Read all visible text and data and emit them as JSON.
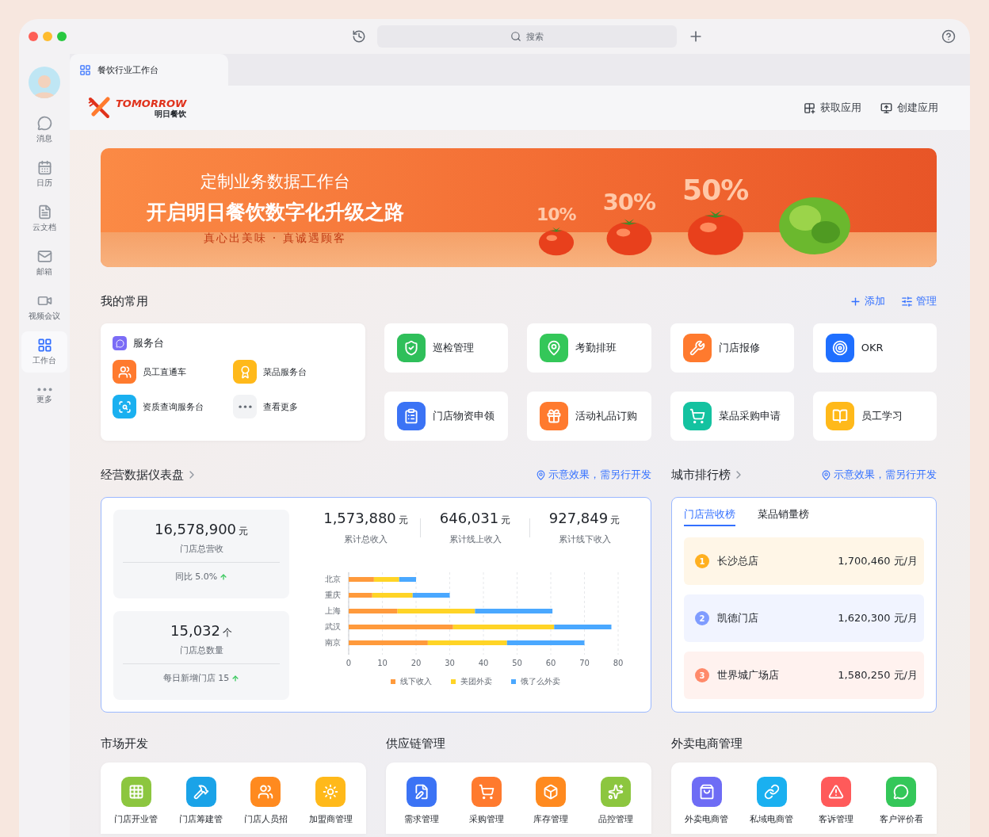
{
  "window": {
    "search_placeholder": "搜索"
  },
  "sidebar": {
    "items": [
      {
        "label": "消息",
        "kind": "chat",
        "selected": false
      },
      {
        "label": "日历",
        "kind": "calendar",
        "selected": false
      },
      {
        "label": "云文档",
        "kind": "docs",
        "selected": false
      },
      {
        "label": "邮箱",
        "kind": "mail",
        "selected": false
      },
      {
        "label": "视频会议",
        "kind": "video",
        "selected": false
      },
      {
        "label": "工作台",
        "kind": "workspace",
        "selected": true
      },
      {
        "label": "更多",
        "kind": "more",
        "selected": false
      }
    ]
  },
  "tab": {
    "title": "餐饮行业工作台"
  },
  "brand": {
    "name": "TOMORROW",
    "subtitle": "明日餐饮"
  },
  "header_actions": [
    {
      "label": "获取应用",
      "kind": "apps"
    },
    {
      "label": "创建应用",
      "kind": "create"
    }
  ],
  "banner": {
    "subtitle": "定制业务数据工作台",
    "title": "开启明日餐饮数字化升级之路",
    "slogan": "真心出美味 · 真诚遇顾客",
    "percents": [
      "10%",
      "30%",
      "50%"
    ]
  },
  "favorites": {
    "title": "我的常用",
    "actions": [
      {
        "label": "添加",
        "kind": "add"
      },
      {
        "label": "管理",
        "kind": "manage"
      }
    ],
    "service_desk": {
      "title": "服务台",
      "items": [
        {
          "label": "员工直通车",
          "kind": "team",
          "color": "#ff7a2e"
        },
        {
          "label": "菜品服务台",
          "kind": "medal",
          "color": "#ffb91a"
        },
        {
          "label": "资质查询服务台",
          "kind": "search",
          "color": "#1ab0f0"
        },
        {
          "label": "查看更多",
          "kind": "more",
          "color": "#f2f3f5"
        }
      ]
    },
    "apps": [
      {
        "label": "巡检管理",
        "kind": "inspect",
        "color": "#2fbf5a"
      },
      {
        "label": "考勤排班",
        "kind": "location",
        "color": "#34c759"
      },
      {
        "label": "门店报修",
        "kind": "repair",
        "color": "#ff7a2e"
      },
      {
        "label": "OKR",
        "kind": "okr",
        "color": "#1f6fff"
      },
      {
        "label": "门店物资申领",
        "kind": "supplies",
        "color": "#3b73f5"
      },
      {
        "label": "活动礼品订购",
        "kind": "gift",
        "color": "#ff7a2e"
      },
      {
        "label": "菜品采购申请",
        "kind": "purchase",
        "color": "#14c2a0"
      },
      {
        "label": "员工学习",
        "kind": "learn",
        "color": "#ffb91a"
      }
    ]
  },
  "dashboard": {
    "title": "经营数据仪表盘",
    "note": "示意效果，需另行开发",
    "stats": [
      {
        "value": "16,578,900",
        "unit": "元",
        "label": "门店总营收",
        "footer": "同比 5.0%"
      },
      {
        "value": "15,032",
        "unit": "个",
        "label": "门店总数量",
        "footer": "每日新增门店 15"
      }
    ],
    "summary": [
      {
        "value": "1,573,880",
        "unit": "元",
        "label": "累计总收入"
      },
      {
        "value": "646,031",
        "unit": "元",
        "label": "累计线上收入"
      },
      {
        "value": "927,849",
        "unit": "元",
        "label": "累计线下收入"
      }
    ],
    "chart_data": {
      "type": "bar",
      "orientation": "horizontal",
      "stacked": true,
      "categories": [
        "北京",
        "重庆",
        "上海",
        "武汉",
        "南京"
      ],
      "series": [
        {
          "name": "线下收入",
          "color": "#ff9a3c",
          "values": [
            7.5,
            7,
            14.5,
            31,
            23.5
          ]
        },
        {
          "name": "美团外卖",
          "color": "#ffd426",
          "values": [
            7.5,
            12,
            23,
            30,
            23.5
          ]
        },
        {
          "name": "饿了么外卖",
          "color": "#4aa8ff",
          "values": [
            5,
            11,
            23,
            17,
            23
          ]
        }
      ],
      "xlim": [
        0,
        80
      ],
      "grid": true,
      "xticks": [
        0,
        10,
        20,
        30,
        40,
        50,
        60,
        70,
        80
      ]
    }
  },
  "ranking": {
    "title": "城市排行榜",
    "note": "示意效果，需另行开发",
    "tabs": [
      {
        "label": "门店营收榜",
        "selected": true
      },
      {
        "label": "菜品销量榜",
        "selected": false
      }
    ],
    "rows": [
      {
        "rank": "1",
        "name": "长沙总店",
        "amount": "1,700,460 元/月",
        "color": "#ffb020"
      },
      {
        "rank": "2",
        "name": "凯德门店",
        "amount": "1,620,300 元/月",
        "color": "#7f9cff"
      },
      {
        "rank": "3",
        "name": "世界城广场店",
        "amount": "1,580,250 元/月",
        "color": "#ff8a6a"
      }
    ]
  },
  "sections": [
    {
      "title": "市场开发",
      "apps": [
        {
          "label": "门店开业管",
          "kind": "grid",
          "color": "#8cc63f"
        },
        {
          "label": "门店筹建管",
          "kind": "build",
          "color": "#1aa3e8"
        },
        {
          "label": "门店人员招",
          "kind": "team",
          "color": "#ff8a1f"
        },
        {
          "label": "加盟商管理",
          "kind": "sun",
          "color": "#ffb91a"
        }
      ]
    },
    {
      "title": "供应链管理",
      "apps": [
        {
          "label": "需求管理",
          "kind": "doc",
          "color": "#3b73f5"
        },
        {
          "label": "采购管理",
          "kind": "purchase",
          "color": "#ff7a2e"
        },
        {
          "label": "库存管理",
          "kind": "box",
          "color": "#ff8a1f"
        },
        {
          "label": "品控管理",
          "kind": "sparkle",
          "color": "#8cc63f"
        }
      ]
    },
    {
      "title": "外卖电商管理",
      "apps": [
        {
          "label": "外卖电商管",
          "kind": "bag",
          "color": "#6e6cf5"
        },
        {
          "label": "私域电商管",
          "kind": "link",
          "color": "#1ab0f0"
        },
        {
          "label": "客诉管理",
          "kind": "alert",
          "color": "#ff5a5a"
        },
        {
          "label": "客户评价看",
          "kind": "chat",
          "color": "#34c759"
        }
      ]
    }
  ]
}
